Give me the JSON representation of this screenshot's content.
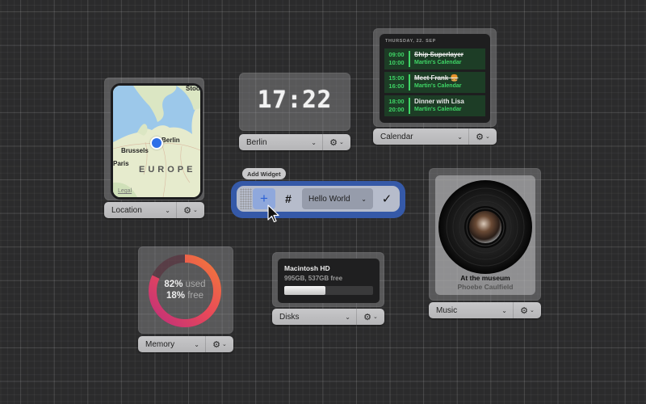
{
  "toolbar": {
    "tooltip": "Add Widget",
    "add_icon": "+",
    "grid_icon": "#",
    "selected_widget": "Hello World",
    "confirm_icon": "✓"
  },
  "widgets": {
    "location": {
      "selector_label": "Location",
      "map_labels": {
        "stockholm": "Stock",
        "berlin": "Berlin",
        "brussels": "Brussels",
        "paris": "Paris",
        "region": "EUROPE",
        "legal": "Legal"
      }
    },
    "clock": {
      "time": "17:22",
      "selector_label": "Berlin"
    },
    "calendar": {
      "selector_label": "Calendar",
      "date": "THURSDAY, 22. SEP",
      "events": [
        {
          "start": "09:00",
          "end": "10:00",
          "title": "Ship Superlayer",
          "calendar": "Martin's Calendar",
          "completed": true
        },
        {
          "start": "15:00",
          "end": "16:00",
          "title": "Meet Frank 🍔",
          "calendar": "Martin's Calendar",
          "completed": true
        },
        {
          "start": "18:00",
          "end": "20:00",
          "title": "Dinner with Lisa",
          "calendar": "Martin's Calendar",
          "completed": false
        }
      ],
      "accent_color": "#3fd566"
    },
    "memory": {
      "selector_label": "Memory",
      "used_percent": 82,
      "free_percent": 18,
      "used_text": "82%",
      "used_word": "used",
      "free_text": "18%",
      "free_word": "free"
    },
    "disks": {
      "selector_label": "Disks",
      "name": "Macintosh HD",
      "total": "995GB",
      "free": "537GB",
      "summary": "995GB, 537GB free",
      "used_fraction": 0.46
    },
    "music": {
      "selector_label": "Music",
      "song": "At the museum",
      "artist": "Phoebe Caulfield"
    }
  },
  "icons": {
    "gear": "⚙",
    "chevron": "⌄"
  },
  "colors": {
    "toolbar_highlight": "#3559a8",
    "add_button": "#2d62d6",
    "location_pin": "#2f6fe8"
  }
}
